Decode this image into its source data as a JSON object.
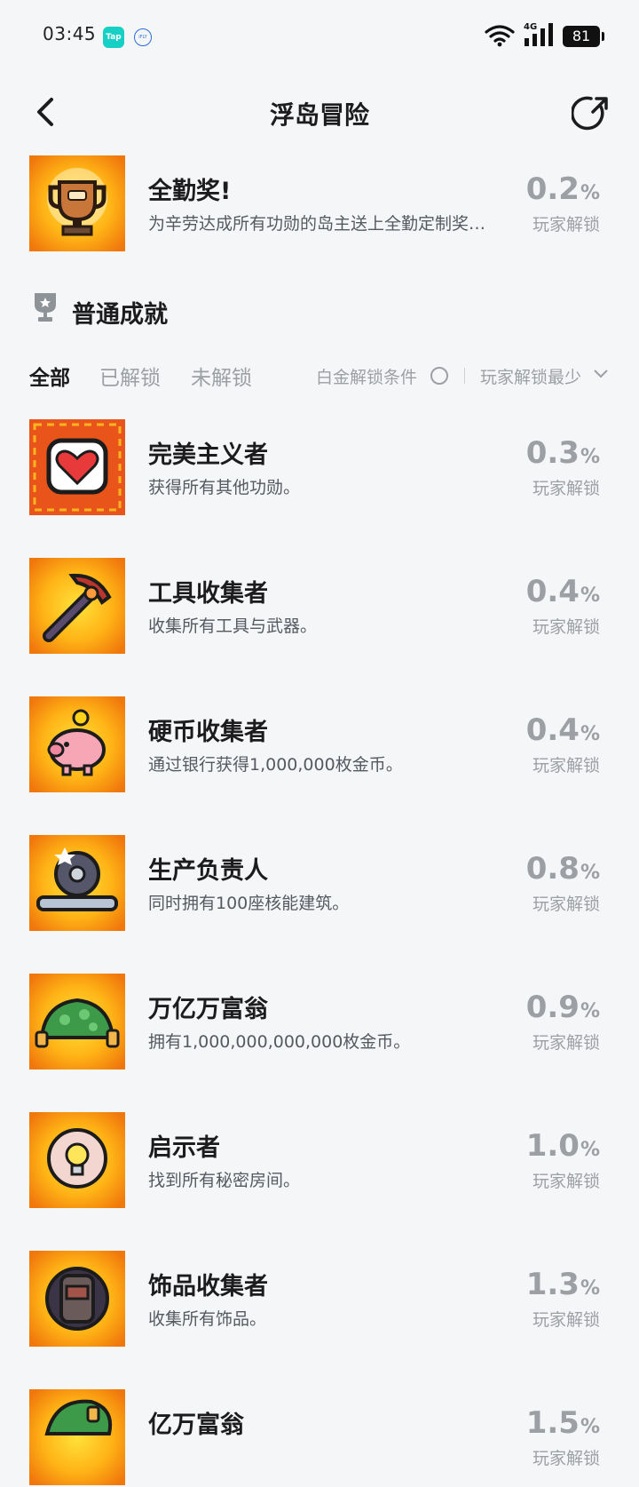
{
  "status_bar": {
    "time": "03:45",
    "tap_badge": "Tap",
    "ifly_badge": "iFLY",
    "network": "4G",
    "battery": "81"
  },
  "header": {
    "title": "浮岛冒险"
  },
  "featured": {
    "name": "全勤奖!",
    "desc": "为辛劳达成所有功勋的岛主送上全勤定制奖杯！",
    "rate": "0.2",
    "unit": "%",
    "label": "玩家解锁"
  },
  "section": {
    "title": "普通成就"
  },
  "filters": {
    "tabs": [
      "全部",
      "已解锁",
      "未解锁"
    ],
    "condition": "白金解锁条件",
    "sort": "玩家解锁最少"
  },
  "achievements": [
    {
      "name": "完美主义者",
      "desc": "获得所有其他功勋。",
      "rate": "0.3",
      "unit": "%",
      "label": "玩家解锁"
    },
    {
      "name": "工具收集者",
      "desc": "收集所有工具与武器。",
      "rate": "0.4",
      "unit": "%",
      "label": "玩家解锁"
    },
    {
      "name": "硬币收集者",
      "desc": "通过银行获得1,000,000枚金币。",
      "rate": "0.4",
      "unit": "%",
      "label": "玩家解锁"
    },
    {
      "name": "生产负责人",
      "desc": "同时拥有100座核能建筑。",
      "rate": "0.8",
      "unit": "%",
      "label": "玩家解锁"
    },
    {
      "name": "万亿万富翁",
      "desc": "拥有1,000,000,000,000枚金币。",
      "rate": "0.9",
      "unit": "%",
      "label": "玩家解锁"
    },
    {
      "name": "启示者",
      "desc": "找到所有秘密房间。",
      "rate": "1.0",
      "unit": "%",
      "label": "玩家解锁"
    },
    {
      "name": "饰品收集者",
      "desc": "收集所有饰品。",
      "rate": "1.3",
      "unit": "%",
      "label": "玩家解锁"
    },
    {
      "name": "亿万富翁",
      "desc": "",
      "rate": "1.5",
      "unit": "%",
      "label": "玩家解锁"
    }
  ],
  "icons": [
    "trophy-icon",
    "heart-icon",
    "pickaxe-icon",
    "piggy-bank-icon",
    "gear-wrench-icon",
    "money-pile-icon",
    "lightbulb-icon",
    "backpack-icon"
  ],
  "colors": {
    "badge_orange": "#f28a0c",
    "badge_yellow": "#ffd21a",
    "muted": "#9c9fa4",
    "text": "#1c1c1e"
  }
}
